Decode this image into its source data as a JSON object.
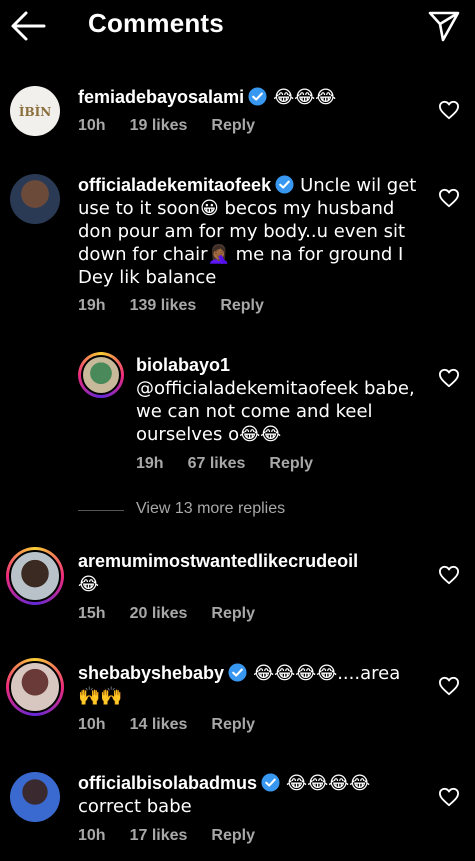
{
  "header": {
    "title": "Comments"
  },
  "comments": [
    {
      "username": "femiadebayosalami",
      "verified": true,
      "text": "😂😂😂",
      "time": "10h",
      "likes": "19 likes",
      "reply": "Reply",
      "avatar_text": "ÌBÌN"
    },
    {
      "username": "officialadekemitaofeek",
      "verified": true,
      "text": "Uncle wil get use to it soon😀 becos my husband don pour am for my body..u even sit down for chair🤦🏾‍♀️ me na for ground I Dey lik balance",
      "time": "19h",
      "likes": "139 likes",
      "reply": "Reply"
    },
    {
      "username": "biolabayo1",
      "verified": false,
      "text": "@officialadekemitaofeek babe, we can not come and keel ourselves o😂😂",
      "time": "19h",
      "likes": "67 likes",
      "reply": "Reply"
    },
    {
      "username": "aremumimostwantedlikecrudeoil",
      "verified": false,
      "text": "😂",
      "time": "15h",
      "likes": "20 likes",
      "reply": "Reply"
    },
    {
      "username": "shebabyshebaby",
      "verified": true,
      "text": "😂😂😂😂....area 🙌🙌",
      "time": "10h",
      "likes": "14 likes",
      "reply": "Reply"
    },
    {
      "username": "officialbisolabadmus",
      "verified": true,
      "text": "😂😂😂😂 correct babe",
      "time": "10h",
      "likes": "17 likes",
      "reply": "Reply"
    }
  ],
  "view_more": "View 13 more replies",
  "colors": {
    "background": "#000000",
    "text": "#ffffff",
    "meta": "#a8a8a8",
    "verified": "#3897f0"
  },
  "icons": {
    "back": "arrow-left-icon",
    "send": "paper-plane-icon",
    "heart": "heart-outline-icon",
    "verified": "verified-badge-icon"
  }
}
